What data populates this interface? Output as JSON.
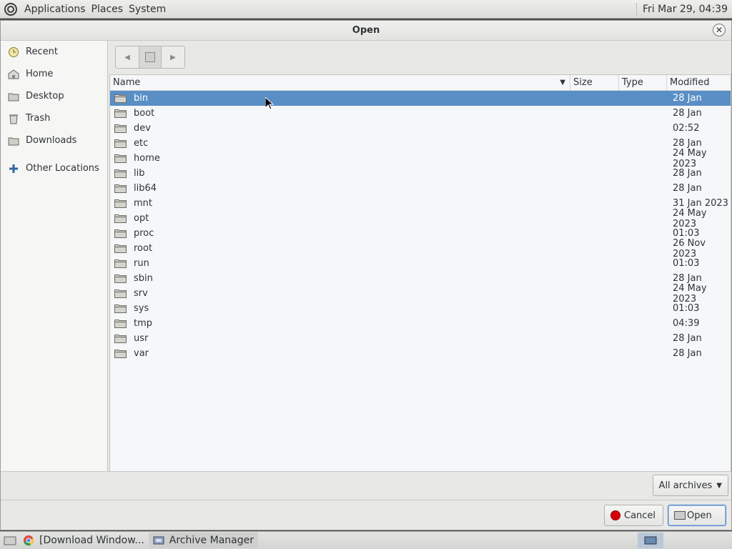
{
  "top_panel": {
    "menus": [
      "Applications",
      "Places",
      "System"
    ],
    "clock": "Fri Mar 29, 04:39"
  },
  "dialog": {
    "title": "Open",
    "sidebar": [
      {
        "label": "Recent",
        "icon": "clock-icon"
      },
      {
        "label": "Home",
        "icon": "home-icon"
      },
      {
        "label": "Desktop",
        "icon": "desktop-icon"
      },
      {
        "label": "Trash",
        "icon": "trash-icon"
      },
      {
        "label": "Downloads",
        "icon": "folder-icon"
      },
      {
        "label": "Other Locations",
        "icon": "plus-icon"
      }
    ],
    "columns": {
      "name": "Name",
      "size": "Size",
      "type": "Type",
      "modified": "Modified"
    },
    "files": [
      {
        "name": "bin",
        "size": "",
        "type": "",
        "modified": "28 Jan",
        "selected": true
      },
      {
        "name": "boot",
        "size": "",
        "type": "",
        "modified": "28 Jan"
      },
      {
        "name": "dev",
        "size": "",
        "type": "",
        "modified": "02:52"
      },
      {
        "name": "etc",
        "size": "",
        "type": "",
        "modified": "28 Jan"
      },
      {
        "name": "home",
        "size": "",
        "type": "",
        "modified": "24 May 2023"
      },
      {
        "name": "lib",
        "size": "",
        "type": "",
        "modified": "28 Jan"
      },
      {
        "name": "lib64",
        "size": "",
        "type": "",
        "modified": "28 Jan"
      },
      {
        "name": "mnt",
        "size": "",
        "type": "",
        "modified": "31 Jan 2023"
      },
      {
        "name": "opt",
        "size": "",
        "type": "",
        "modified": "24 May 2023"
      },
      {
        "name": "proc",
        "size": "",
        "type": "",
        "modified": "01:03"
      },
      {
        "name": "root",
        "size": "",
        "type": "",
        "modified": "26 Nov 2023"
      },
      {
        "name": "run",
        "size": "",
        "type": "",
        "modified": "01:03"
      },
      {
        "name": "sbin",
        "size": "",
        "type": "",
        "modified": "28 Jan"
      },
      {
        "name": "srv",
        "size": "",
        "type": "",
        "modified": "24 May 2023"
      },
      {
        "name": "sys",
        "size": "",
        "type": "",
        "modified": "01:03"
      },
      {
        "name": "tmp",
        "size": "",
        "type": "",
        "modified": "04:39"
      },
      {
        "name": "usr",
        "size": "",
        "type": "",
        "modified": "28 Jan"
      },
      {
        "name": "var",
        "size": "",
        "type": "",
        "modified": "28 Jan"
      }
    ],
    "filter": "All archives",
    "cancel_label": "Cancel",
    "open_label": "Open"
  },
  "taskbar": {
    "items": [
      {
        "label": "[Download Window...",
        "icon": "chrome-icon",
        "active": false
      },
      {
        "label": "Archive Manager",
        "icon": "archive-manager-icon",
        "active": true
      }
    ]
  },
  "colors": {
    "selection": "#5a8fc6",
    "accent": "#4a7fc0"
  }
}
